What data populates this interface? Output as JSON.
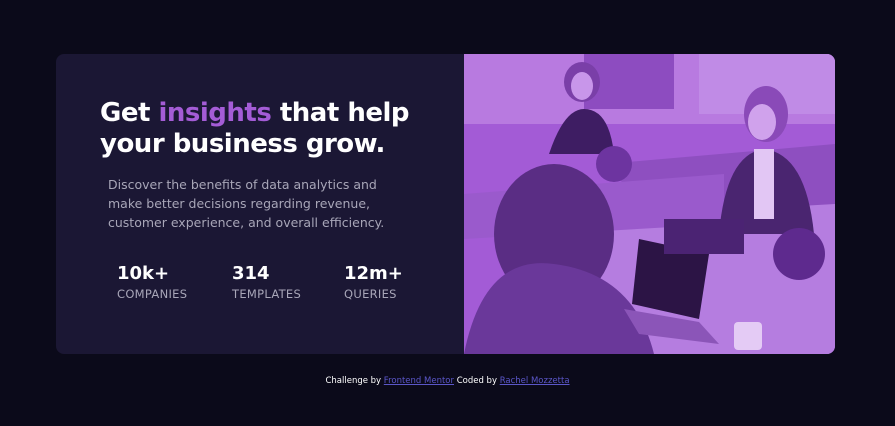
{
  "hero": {
    "headline_before": "Get ",
    "headline_accent": "insights",
    "headline_after": " that help your business grow.",
    "description": "Discover the benefits of data analytics and make better decisions regarding revenue, customer experience, and overall efficiency."
  },
  "stats": [
    {
      "value": "10k+",
      "label": "COMPANIES"
    },
    {
      "value": "314",
      "label": "TEMPLATES"
    },
    {
      "value": "12m+",
      "label": "QUERIES"
    }
  ],
  "footer": {
    "challenge_prefix": "Challenge by ",
    "challenge_link": "Frontend Mentor",
    "coded_prefix": " Coded by ",
    "coded_link": "Rachel Mozzetta"
  },
  "colors": {
    "background": "#0b0a1a",
    "card": "#1b1734",
    "accent": "#a45cd6",
    "photo_overlay": "#a35bd6",
    "link": "#5b57c9"
  }
}
